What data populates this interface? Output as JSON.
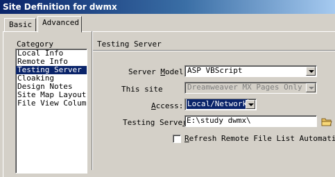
{
  "window": {
    "title": "Site Definition for dwmx"
  },
  "tabs": [
    {
      "label": "Basic"
    },
    {
      "label": "Advanced"
    }
  ],
  "category": {
    "label": "Category",
    "items": [
      {
        "label": "Local Info"
      },
      {
        "label": "Remote Info"
      },
      {
        "label": "Testing Server",
        "selected": true
      },
      {
        "label": "Cloaking"
      },
      {
        "label": "Design Notes"
      },
      {
        "label": "Site Map Layout"
      },
      {
        "label": "File View Columns"
      }
    ]
  },
  "section": {
    "title": "Testing Server"
  },
  "form": {
    "server_model": {
      "label_pre": "Server ",
      "label_u": "M",
      "label_post": "odel:",
      "value": "ASP VBScript"
    },
    "this_site": {
      "label": "This site",
      "value": "Dreamweaver MX Pages Only"
    },
    "access": {
      "label_pre": "",
      "label_u": "A",
      "label_post": "ccess:",
      "value": "Local/Network"
    },
    "testing_server": {
      "label_pre": "Testing Serve",
      "label_u": "r",
      "label_post": "",
      "value": "E:\\study dwmx\\"
    },
    "refresh": {
      "label_u": "R",
      "label_post": "efresh Remote File List Automatic",
      "checked": false
    }
  },
  "colors": {
    "selection": "#0a246a",
    "face": "#d4d0c8",
    "folder": "#e8c060"
  },
  "icons": {
    "folder": "folder-icon",
    "dropdown": "chevron-down-icon"
  }
}
